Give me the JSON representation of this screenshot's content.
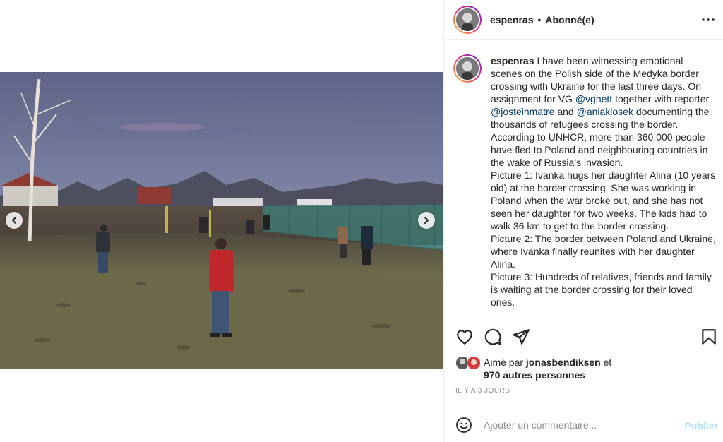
{
  "post": {
    "username": "espenras",
    "separator": "•",
    "follow_state": "Abonné(e)",
    "more_icon": "more-horizontal-icon"
  },
  "caption": {
    "username": "espenras",
    "segments": [
      {
        "type": "text",
        "value": " I have been witnessing emotional scenes on the Polish side of the Medyka border crossing with Ukraine for the last three days. On assignment for VG "
      },
      {
        "type": "mention",
        "value": "@vgnett"
      },
      {
        "type": "text",
        "value": " together with reporter "
      },
      {
        "type": "mention",
        "value": "@josteinmatre"
      },
      {
        "type": "text",
        "value": " and "
      },
      {
        "type": "mention",
        "value": "@aniaklosek"
      },
      {
        "type": "text",
        "value": " documenting the thousands of refugees crossing the border. According to UNHCR, more than 360.000 people have fled to Poland and neighbouring countries in the wake of Russia’s invasion."
      }
    ],
    "paragraphs": [
      "Picture 1: Ivanka hugs her daughter Alina (10 years old) at the border crossing. She was working in Poland when the war broke out, and she has not seen her daughter for two weeks. The kids had to walk 36 km to get to the border crossing.",
      "Picture 2: The border between Poland and Ukraine, where Ivanka finally reunites with her daughter Alina.",
      "Picture 3: Hundreds of relatives, friends and family is waiting at the border crossing for their loved ones."
    ]
  },
  "actions": {
    "like_icon": "heart-icon",
    "comment_icon": "comment-bubble-icon",
    "share_icon": "paper-plane-icon",
    "save_icon": "bookmark-icon"
  },
  "likes": {
    "prefix": "Aimé par ",
    "user": "jonasbendiksen",
    "suffix": " et",
    "others": "970 autres personnes"
  },
  "timestamp": "IL Y A 3 JOURS",
  "comment": {
    "emoji_icon": "smiley-icon",
    "placeholder": "Ajouter un commentaire...",
    "post_label": "Publier"
  },
  "carousel": {
    "prev_icon": "chevron-left-icon",
    "next_icon": "chevron-right-icon"
  },
  "colors": {
    "mention": "#00376b",
    "post_disabled": "#b2dffc",
    "border": "#efefef",
    "muted": "#8e8e8e"
  }
}
